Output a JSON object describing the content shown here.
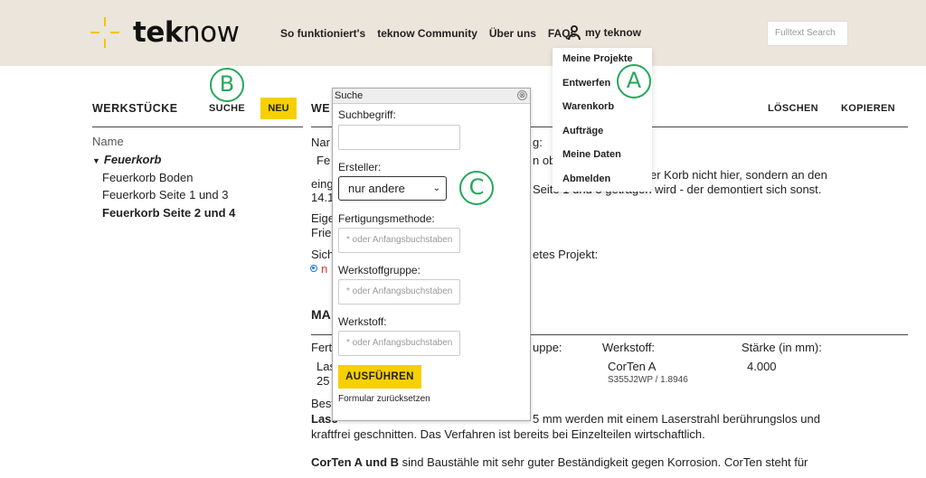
{
  "header": {
    "logo_bold": "tek",
    "logo_rest": "now",
    "nav": [
      "So funktioniert's",
      "teknow Community",
      "Über uns",
      "FAQs"
    ],
    "my_teknow": "my teknow",
    "search_placeholder": "Fulltext Search"
  },
  "dropdown": {
    "items": [
      "Meine Projekte",
      "Entwerfen",
      "Warenkorb",
      "Aufträge",
      "Meine Daten",
      "Abmelden"
    ]
  },
  "annotations": {
    "a": "A",
    "b": "B",
    "c": "C"
  },
  "left": {
    "title": "WERKSTÜCKE",
    "search_button": "SUCHE",
    "new_button": "NEU",
    "tree_header": "Name",
    "tree_root": "Feuerkorb",
    "tree_items": [
      "Feuerkorb Boden",
      "Feuerkorb Seite 1 und 3",
      "Feuerkorb Seite 2 und 4"
    ]
  },
  "right": {
    "title_frag": "WE",
    "delete_button": "LÖSCHEN",
    "copy_button": "KOPIEREN",
    "fragments": {
      "nam": "Nar",
      "fe": "Fe",
      "eing": "eing",
      "date": "14.1",
      "eige": "Eige",
      "frie": "Frie",
      "sich": "Sich",
      "g_colon": "g:",
      "oben": "n oben eingehängt",
      "korb": "er Korb nicht hier, sondern an den",
      "seite": "Seite 1 und 3 getragen wird - der demontiert sich sonst.",
      "etes": "etes Projekt:",
      "ma": "MA",
      "fert": "Fert",
      "ruppe": "uppe:",
      "werkstoff_label": "Werkstoff:",
      "staerke_label": "Stärke (in mm):",
      "las": "Las",
      "n25": "25",
      "werkstoff_value": "CorTen A",
      "werkstoff_code": "S355J2WP / 1.8946",
      "staerke_value": "4.000",
      "best": "Best",
      "lase": "Lase",
      "laser_line": "5 mm werden mit einem Laserstrahl berührungslos und",
      "kraftfrei": "kraftfrei geschnitten. Das Verfahren ist bereits bei Einzelteilen wirtschaftlich.",
      "corten_bold": "CorTen A und B",
      "corten_rest": " sind Baustähle mit sehr guter Beständigkeit gegen Korrosion. CorTen steht für"
    }
  },
  "search_dialog": {
    "title": "Suche",
    "close": "⊗",
    "term_label": "Suchbegriff:",
    "term_value": "",
    "creator_label": "Ersteller:",
    "creator_value": "nur andere",
    "method_label": "Fertigungsmethode:",
    "method_placeholder": "* oder Anfangsbuchstaben",
    "group_label": "Werkstoffgruppe:",
    "group_placeholder": "* oder Anfangsbuchstaben",
    "material_label": "Werkstoff:",
    "material_placeholder": "* oder Anfangsbuchstaben",
    "run_button": "AUSFÜHREN",
    "reset_link": "Formular zurücksetzen"
  }
}
